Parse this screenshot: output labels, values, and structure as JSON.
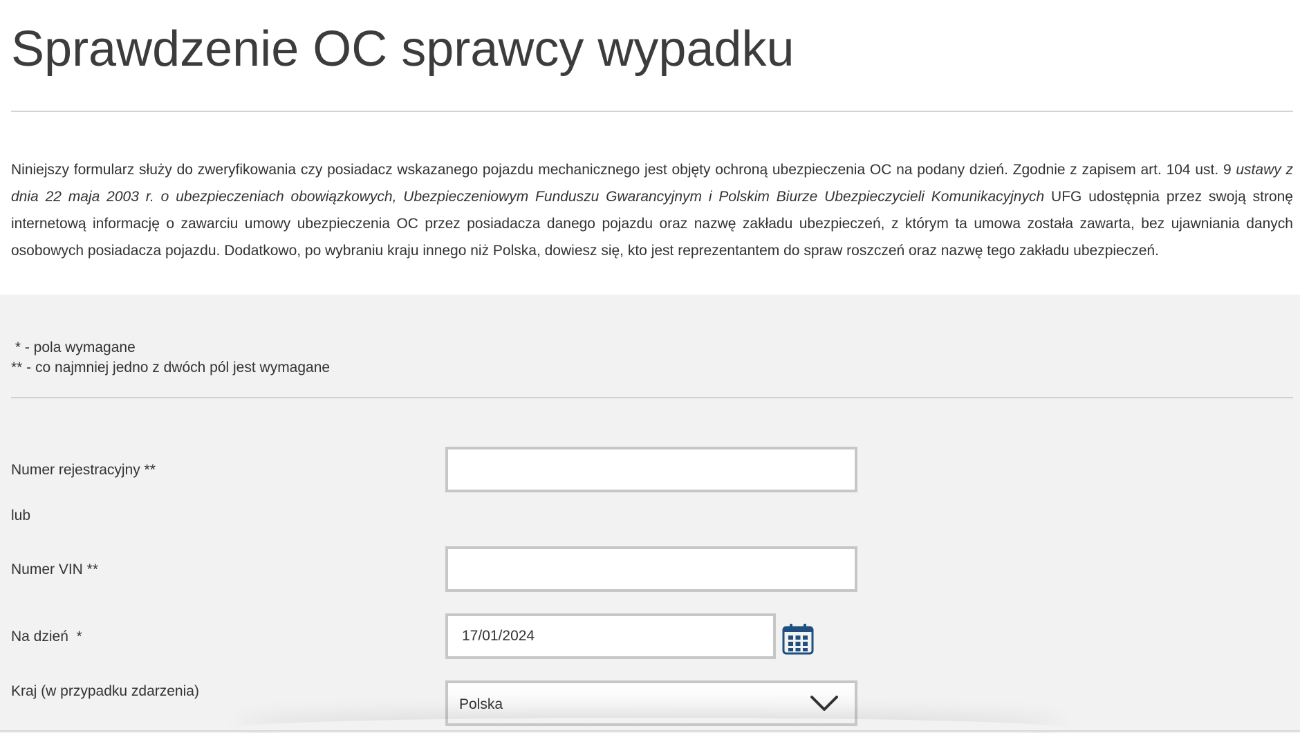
{
  "page": {
    "title": "Sprawdzenie OC sprawcy wypadku"
  },
  "intro": {
    "part1": "Niniejszy formularz służy do zweryfikowania czy posiadacz wskazanego pojazdu mechanicznego jest objęty ochroną ubezpieczenia OC na podany dzień. Zgodnie z zapisem art. 104 ust. 9 ",
    "law": "ustawy z dnia 22 maja 2003 r. o ubezpieczeniach obowiązkowych, Ubezpieczeniowym Funduszu Gwarancyjnym i Polskim Biurze Ubezpieczycieli Komunikacyjnych",
    "part2": " UFG udostępnia przez swoją stronę internetową informację o zawarciu umowy ubezpieczenia OC przez posiadacza danego pojazdu oraz nazwę zakładu ubezpieczeń, z którym ta umowa została zawarta, bez ujawniania danych osobowych posiadacza pojazdu. Dodatkowo, po wybraniu kraju innego niż Polska, dowiesz się, kto jest reprezentantem do spraw roszczeń oraz nazwę tego zakładu ubezpieczeń."
  },
  "legend": {
    "required": " * - pola wymagane",
    "one_of_two": "** - co najmniej jedno z dwóch pól jest wymagane"
  },
  "form": {
    "registration_label": "Numer rejestracyjny **",
    "registration_value": "",
    "or_label": "lub",
    "vin_label": "Numer VIN **",
    "vin_value": "",
    "date_label": "Na dzień  *",
    "date_value": "17/01/2024",
    "country_label": "Kraj (w przypadku zdarzenia)",
    "country_value": "Polska"
  },
  "colors": {
    "calendar_icon": "#1f4f7f",
    "form_background": "#f2f2f2"
  }
}
